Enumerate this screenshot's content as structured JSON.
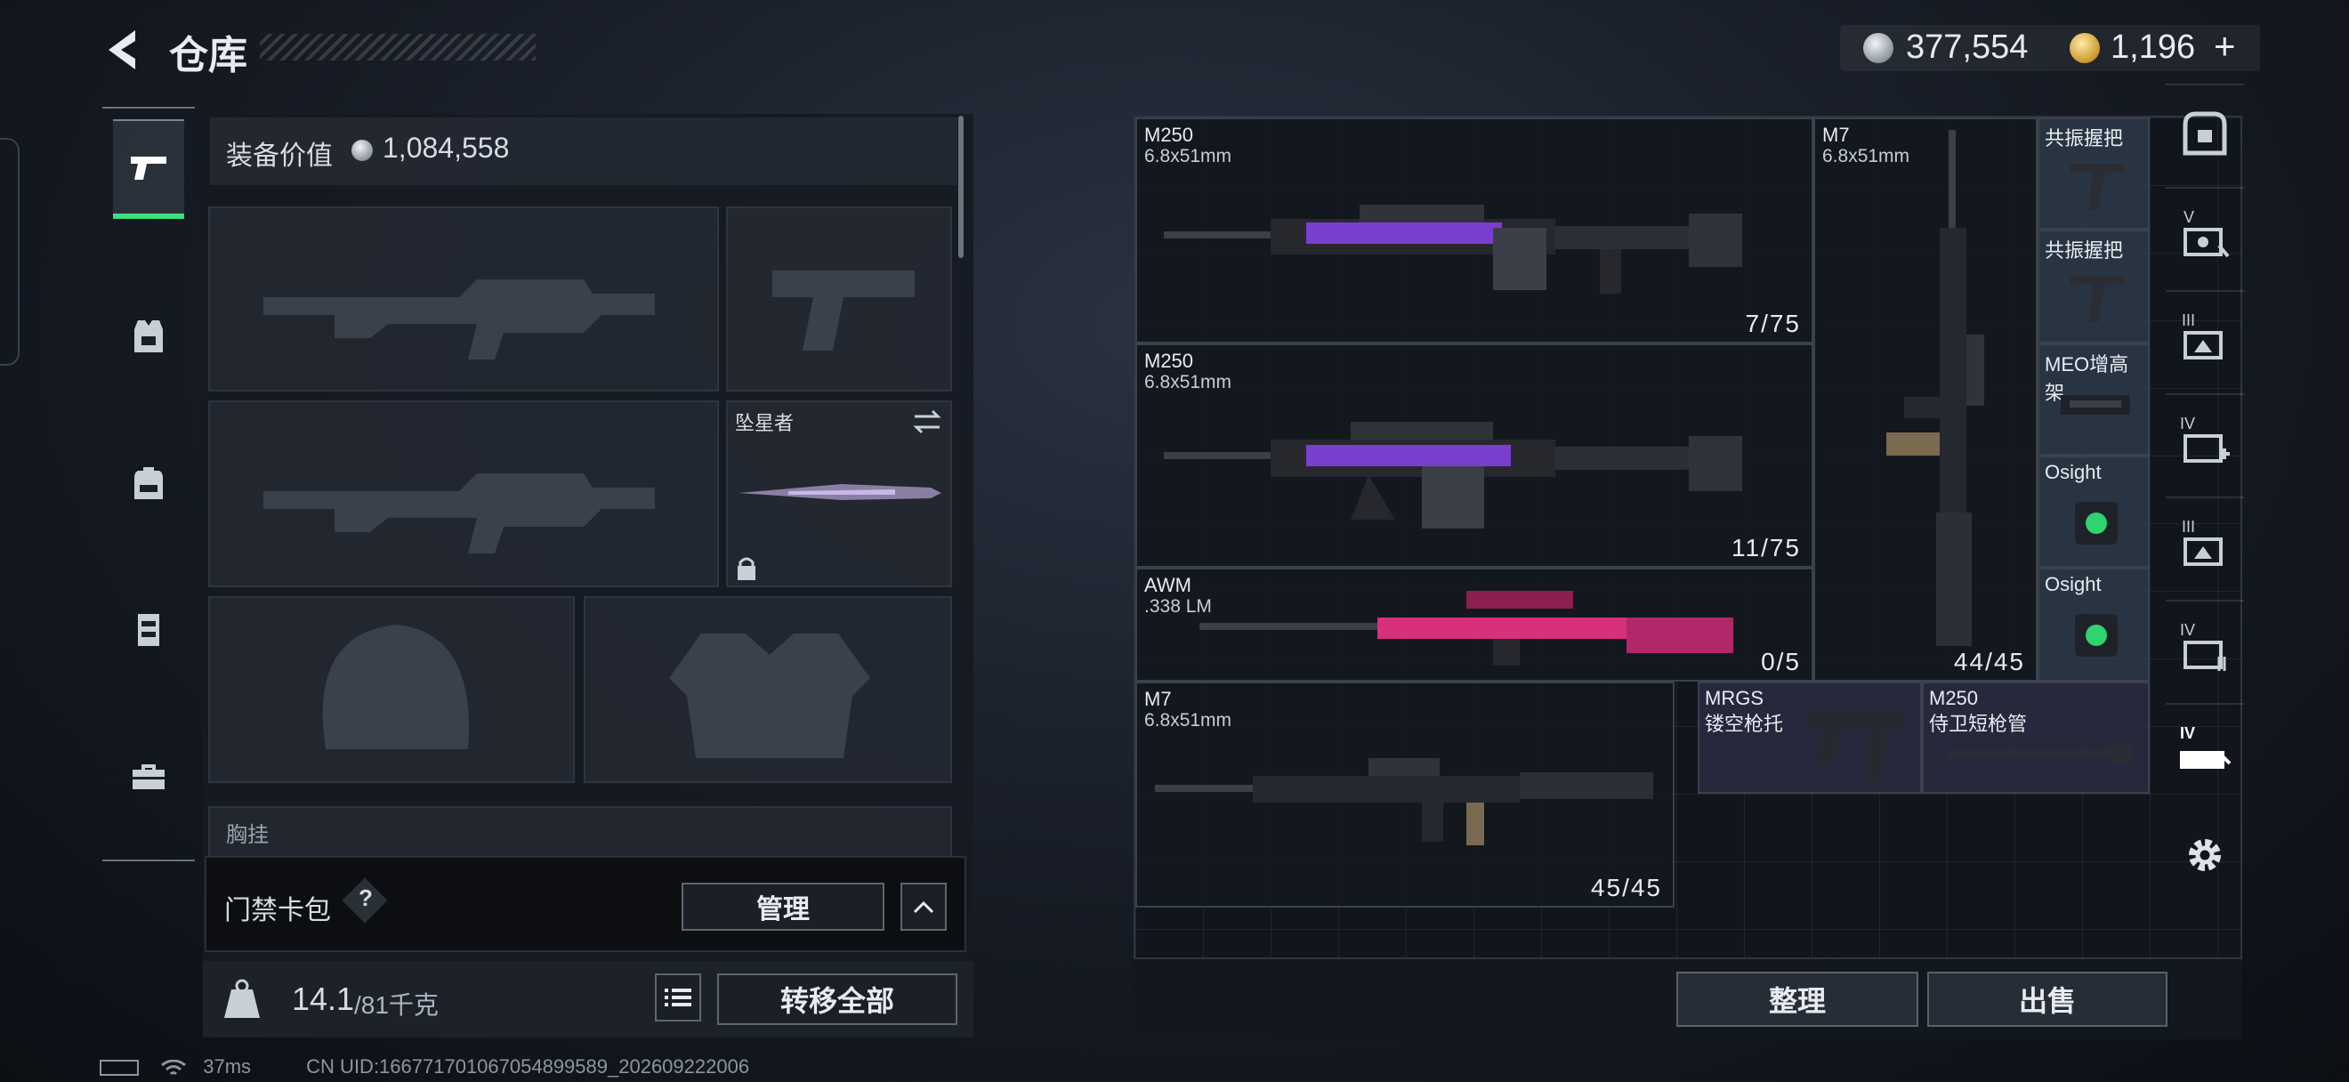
{
  "header": {
    "title": "仓库",
    "currency_silver": "377,554",
    "currency_gold": "1,196",
    "add_symbol": "+"
  },
  "left_panel": {
    "equip_value_label": "装备价值",
    "equip_value": "1,084,558",
    "melee_slot_name": "坠星者",
    "chest_label": "胸挂",
    "card_pack_label": "门禁卡包",
    "card_pack_help": "?",
    "manage_button": "管理",
    "weight_current": "14.1",
    "weight_max": "/81千克",
    "transfer_all_button": "转移全部"
  },
  "weapons": [
    {
      "name": "M250",
      "caliber": "6.8x51mm",
      "ammo": "7/75",
      "skin": "purple-camo"
    },
    {
      "name": "M250",
      "caliber": "6.8x51mm",
      "ammo": "11/75",
      "skin": "purple-camo"
    },
    {
      "name": "AWM",
      "caliber": ".338 LM",
      "ammo": "0/5",
      "skin": "pink-camo"
    },
    {
      "name": "M7",
      "caliber": "6.8x51mm",
      "ammo": "45/45",
      "skin": "black"
    },
    {
      "name": "M7",
      "caliber": "6.8x51mm",
      "ammo": "44/45",
      "skin": "black"
    }
  ],
  "attachments": [
    {
      "name": "共振握把"
    },
    {
      "name": "共振握把"
    },
    {
      "name": "MEO增高架"
    },
    {
      "name": "Osight"
    },
    {
      "name": "Osight"
    },
    {
      "name": "MRGS",
      "sub": "镂空枪托"
    },
    {
      "name": "M250",
      "sub": "侍卫短枪管"
    }
  ],
  "grid_footer": {
    "sort_button": "整理",
    "sell_button": "出售"
  },
  "right_nav": {
    "labels": [
      "V",
      "III",
      "IV",
      "III",
      "IV",
      "IV"
    ]
  },
  "status_bar": {
    "ping": "37ms",
    "uid": "CN UID:1667717010670548995​89_202609222006"
  },
  "colors": {
    "accent_green": "#3de07f",
    "skin_purple": "#7b3fd0",
    "skin_pink": "#d8307a"
  }
}
